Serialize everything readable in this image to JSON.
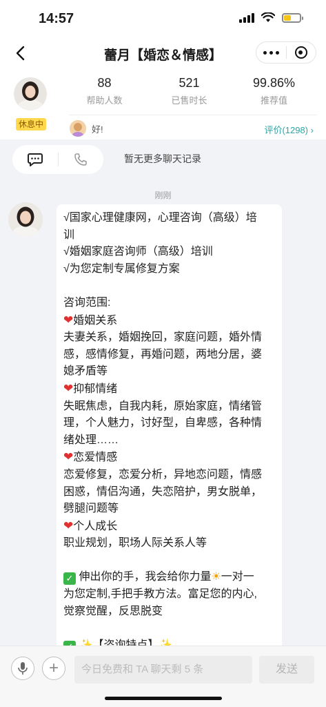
{
  "status_bar": {
    "time": "14:57",
    "battery_level": 0.4
  },
  "nav": {
    "title": "蕾月【婚恋＆情感】"
  },
  "profile": {
    "status_tag": "休息中",
    "stats": [
      {
        "value": "88",
        "label": "帮助人数"
      },
      {
        "value": "521",
        "label": "已售时长"
      },
      {
        "value": "99.86%",
        "label": "推荐值"
      }
    ],
    "review_text": "好!",
    "review_link": "评价(1298)",
    "review_chevron": "›"
  },
  "chat": {
    "no_more_history": "暂无更多聊天记录",
    "timestamp": "刚刚",
    "message_lines": [
      {
        "text": "√国家心理健康网，心理咨询（高级）培"
      },
      {
        "text": "训"
      },
      {
        "text": "√婚姻家庭咨询师（高级）培训"
      },
      {
        "text": "√为您定制专属修复方案"
      },
      {
        "text": ""
      },
      {
        "text": "咨询范围:"
      },
      {
        "icon": "❤",
        "text": "婚姻关系"
      },
      {
        "text": "夫妻关系，婚姻挽回，家庭问题，婚外情"
      },
      {
        "text": "感，感情修复，再婚问题，两地分居，婆"
      },
      {
        "text": "媳矛盾等"
      },
      {
        "icon": "❤",
        "text": "抑郁情绪"
      },
      {
        "text": "失眠焦虑，自我内耗，原始家庭，情绪管"
      },
      {
        "text": "理，个人魅力，讨好型，自卑感，各种情"
      },
      {
        "text": "绪处理……"
      },
      {
        "icon": "❤",
        "text": "恋爱情感"
      },
      {
        "text": "恋爱修复，恋爱分析，异地恋问题，情感"
      },
      {
        "text": "困惑，情侣沟通，失恋陪护，男女脱单，"
      },
      {
        "text": "劈腿问题等"
      },
      {
        "icon": "❤",
        "text": "个人成长"
      },
      {
        "text": "职业规划，职场人际关系人等"
      },
      {
        "text": ""
      },
      {
        "check": "✓",
        "text": " 伸出你的手，我会给你力量",
        "sun": "☀",
        "tail": "一对一"
      },
      {
        "text": "为您定制,手把手教方法。富足您的内心,"
      },
      {
        "text": "觉察觉醒，反思脱变"
      },
      {
        "text": ""
      },
      {
        "check": "✓",
        "text": " ✨【咨询特点】✨"
      }
    ]
  },
  "input_bar": {
    "placeholder": "今日免费和 TA 聊天剩 5 条",
    "plus": "+",
    "send_label": "发送"
  }
}
